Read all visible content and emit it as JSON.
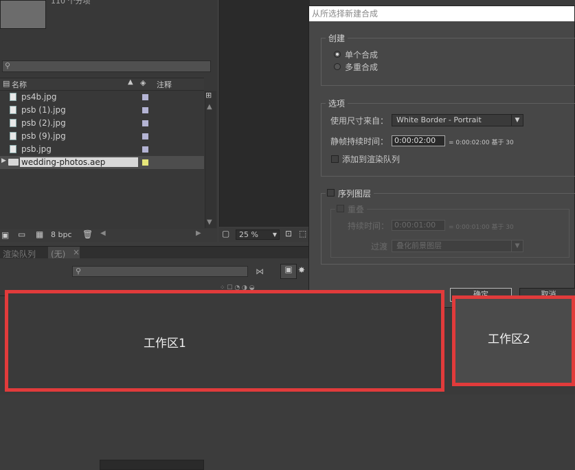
{
  "project": {
    "thumb_info": "110 个分项",
    "search_icon": "search-icon",
    "columns": {
      "name": "名称",
      "comment": "注释"
    },
    "files": [
      {
        "name": "ps4b.jpg",
        "type": "image",
        "label_color": "#b4b4d4"
      },
      {
        "name": "psb (1).jpg",
        "type": "image",
        "label_color": "#b4b4d4"
      },
      {
        "name": "psb (2).jpg",
        "type": "image",
        "label_color": "#b4b4d4"
      },
      {
        "name": "psb (9).jpg",
        "type": "image",
        "label_color": "#b4b4d4"
      },
      {
        "name": "psb.jpg",
        "type": "image",
        "label_color": "#b4b4d4"
      },
      {
        "name": "wedding-photos.aep",
        "type": "folder",
        "label_color": "#e6e67a",
        "selected": true
      }
    ],
    "bpc": "8 bpc"
  },
  "viewer": {
    "zoom": "25 %"
  },
  "timeline": {
    "tab_render": "渲染队列",
    "tab_none": "(无)",
    "tab_close": "×"
  },
  "dialog": {
    "title": "从所选择新建合成",
    "create": {
      "legend": "创建",
      "single": "单个合成",
      "multiple": "多重合成",
      "selected": "single"
    },
    "options": {
      "legend": "选项",
      "size_label": "使用尺寸来自：",
      "size_value": "White Border - Portrait",
      "still_label": "静帧持续时间：",
      "still_value": "0:00:02:00",
      "still_info": "= 0:00:02:00  基于 30",
      "render_label": "添加到渲染队列",
      "render_checked": false
    },
    "sequence": {
      "legend": "序列图层",
      "checked": false,
      "overlap_label": "重叠",
      "duration_label": "持续时间：",
      "duration_value": "0:00:01:00",
      "duration_info": "= 0:00:01:00  基于 30",
      "transition_label": "过渡",
      "transition_value": "叠化前景图层"
    },
    "ok": "确定",
    "cancel": "取消"
  },
  "annotations": {
    "work1": "工作区1",
    "work2": "工作区2",
    "color": "#e13b3b"
  }
}
